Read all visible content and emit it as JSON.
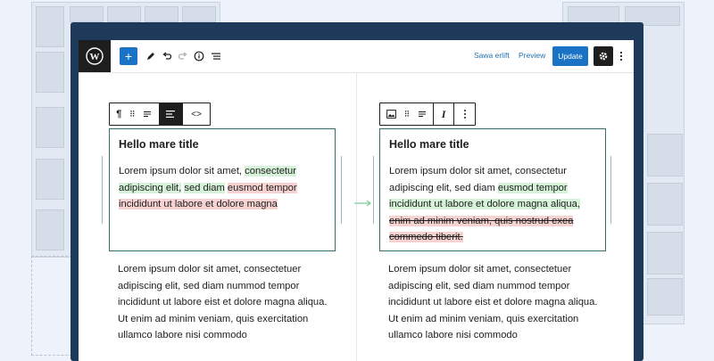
{
  "topbar": {
    "add_label": "+",
    "preview_label": "Preview",
    "switch_label": "Sawa erlift",
    "update_label": "Update"
  },
  "left_block": {
    "title": "Hello mare title",
    "p1_plain1": "Lorem ipsum dolor sit amet, ",
    "p1_add1": "consectetur adipiscing elit,",
    "p1_plain2": " ",
    "p1_add2": "sed diam",
    "p1_plain3": " ",
    "p1_del1": "eusmod tempor incididunt ut labore et dolore magna"
  },
  "right_block": {
    "title": "Hello mare title",
    "p1_plain1": "Lorem ipsum dolor sit amet, consectetur adipiscing elit, sed diam ",
    "p1_add1": "eusmod tempor incididunt ut labore et dolore magna aliqua,",
    "p1_plain2": " ",
    "p1_del1": "enim ad minim veniam, quis nostrud exea commedo tiberit."
  },
  "left_body": "Lorem ipsum dolor sit amet, consectetuer adipiscing elit, sed diam nummod tempor incididunt ut labore eist et dolore magna aliqua. Ut enim ad minim veniam, quis exercitation ullamco labore nisi commodo",
  "right_body": "Lorem ipsum dolor sit amet, consectetuer adipiscing elit, sed diam nummod tempor incididunt ut labore eist et dolore magna aliqua. Ut enim ad minim veniam, quis exercitation ullamco labore nisi commodo",
  "colors": {
    "frame": "#1d3a5a",
    "accent": "#1a73c4",
    "added": "#d6f3da",
    "removed": "#f6d3d1"
  }
}
